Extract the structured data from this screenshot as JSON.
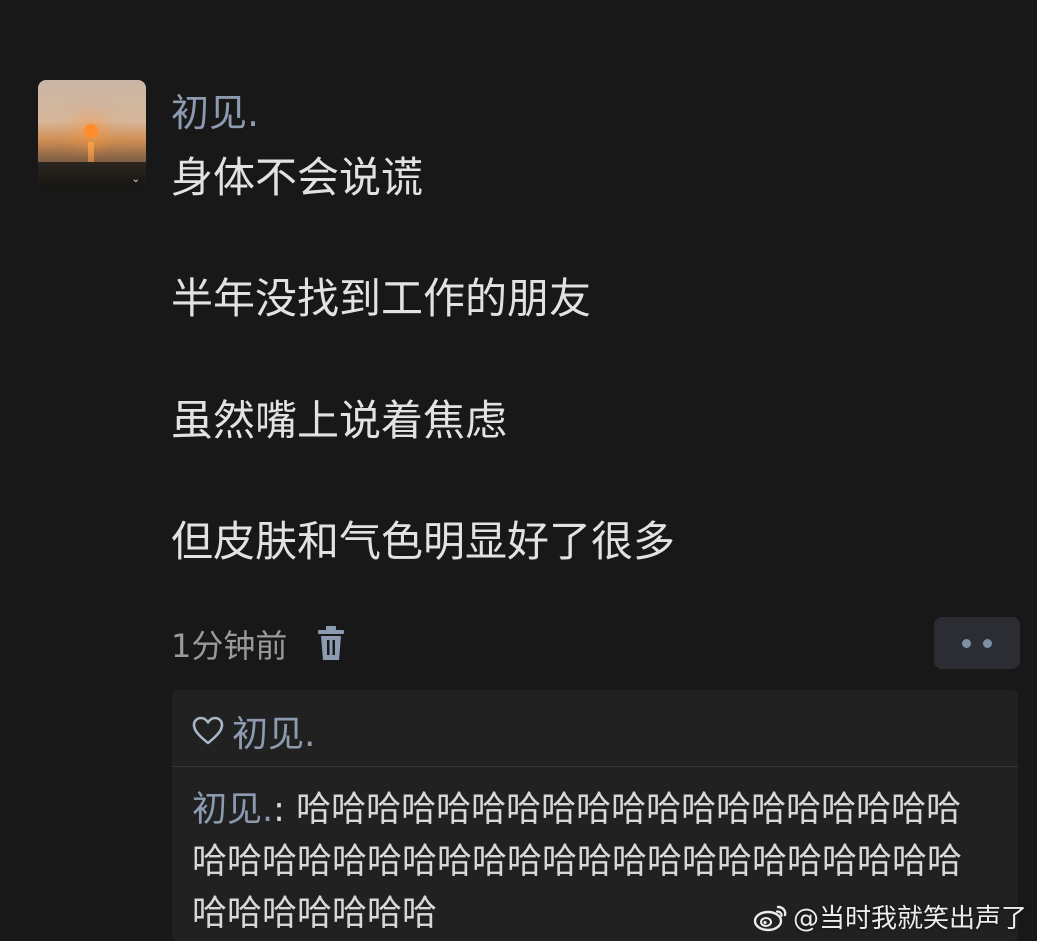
{
  "post": {
    "author": "初见.",
    "lines": [
      "身体不会说谎",
      "半年没找到工作的朋友",
      "虽然嘴上说着焦虑",
      "但皮肤和气色明显好了很多"
    ],
    "time": "1分钟前"
  },
  "reply_box": {
    "liked_by": "初见.",
    "comment_author": "初见.",
    "comment_separator": ": ",
    "comment_text": "哈哈哈哈哈哈哈哈哈哈哈哈哈哈哈哈哈哈哈哈哈哈哈哈哈哈哈哈哈哈哈哈哈哈哈哈哈哈哈哈哈哈哈哈哈哈哈哈"
  },
  "watermark": {
    "text": "@当时我就笑出声了"
  },
  "icons": {
    "delete": "trash-icon",
    "more": "more-dots-icon",
    "like": "heart-outline-icon",
    "watermark": "weibo-logo-icon"
  },
  "colors": {
    "background": "#181818",
    "name_accent": "#8d9bb0",
    "text": "#e2e2e2",
    "reply_bg": "#212122"
  }
}
